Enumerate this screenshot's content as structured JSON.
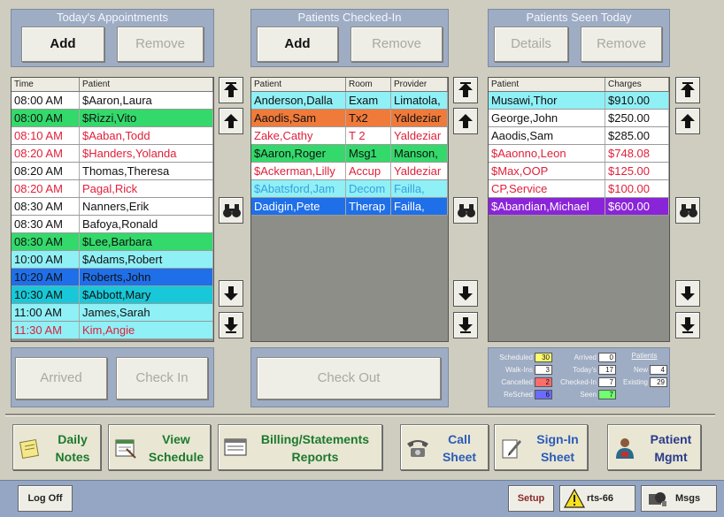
{
  "appointments": {
    "title": "Today's Appointments",
    "add_label": "Add",
    "remove_label": "Remove",
    "columns": [
      "Time",
      "Patient"
    ],
    "rows": [
      {
        "time": "08:00 AM",
        "patient": "$Aaron,Laura",
        "bg": "#ffffff",
        "fg": "#111111"
      },
      {
        "time": "08:00 AM",
        "patient": "$Rizzi,Vito",
        "bg": "#33d96b",
        "fg": "#111111"
      },
      {
        "time": "08:10 AM",
        "patient": "$Aaban,Todd",
        "bg": "#ffffff",
        "fg": "#e0203a"
      },
      {
        "time": "08:20 AM",
        "patient": "$Handers,Yolanda",
        "bg": "#ffffff",
        "fg": "#e0203a"
      },
      {
        "time": "08:20 AM",
        "patient": "Thomas,Theresa",
        "bg": "#ffffff",
        "fg": "#111111"
      },
      {
        "time": "08:20 AM",
        "patient": "Pagal,Rick",
        "bg": "#ffffff",
        "fg": "#e0203a"
      },
      {
        "time": "08:30 AM",
        "patient": "Nanners,Erik",
        "bg": "#ffffff",
        "fg": "#111111"
      },
      {
        "time": "08:30 AM",
        "patient": "Bafoya,Ronald",
        "bg": "#ffffff",
        "fg": "#111111"
      },
      {
        "time": "08:30 AM",
        "patient": "$Lee,Barbara",
        "bg": "#33d96b",
        "fg": "#111111"
      },
      {
        "time": "10:00 AM",
        "patient": "$Adams,Robert",
        "bg": "#8ff0f6",
        "fg": "#111111"
      },
      {
        "time": "10:20 AM",
        "patient": "Roberts,John",
        "bg": "#1f6fe8",
        "fg": "#111111"
      },
      {
        "time": "10:30 AM",
        "patient": "$Abbott,Mary",
        "bg": "#18c8d8",
        "fg": "#111111"
      },
      {
        "time": "11:00 AM",
        "patient": "James,Sarah",
        "bg": "#8ff0f6",
        "fg": "#111111"
      },
      {
        "time": "11:30 AM",
        "patient": "Kim,Angie",
        "bg": "#8ff0f6",
        "fg": "#e0203a"
      }
    ]
  },
  "checked_in": {
    "title": "Patients Checked-In",
    "add_label": "Add",
    "remove_label": "Remove",
    "columns": [
      "Patient",
      "Room",
      "Provider"
    ],
    "rows": [
      {
        "patient": "Anderson,Dalla",
        "room": "Exam",
        "provider": "Limatola,",
        "bg": "#8ff0f6",
        "fg": "#111111"
      },
      {
        "patient": "Aaodis,Sam",
        "room": "Tx2",
        "provider": "Yaldeziar",
        "bg": "#f07a3a",
        "fg": "#111111"
      },
      {
        "patient": "Zake,Cathy",
        "room": "T 2",
        "provider": "Yaldeziar",
        "bg": "#ffffff",
        "fg": "#e0203a"
      },
      {
        "patient": "$Aaron,Roger",
        "room": "Msg1",
        "provider": "Manson,",
        "bg": "#33d96b",
        "fg": "#111111"
      },
      {
        "patient": "$Ackerman,Lilly",
        "room": "Accup",
        "provider": "Yaldeziar",
        "bg": "#ffffff",
        "fg": "#e0203a"
      },
      {
        "patient": "$Abatsford,Jam",
        "room": "Decom",
        "provider": "Failla,",
        "bg": "#8ff0f6",
        "fg": "#3aa0e0"
      },
      {
        "patient": "Dadigin,Pete",
        "room": "Therap",
        "provider": "Failla,",
        "bg": "#1f6fe8",
        "fg": "#ffffff"
      }
    ],
    "checkout_label": "Check Out"
  },
  "seen_today": {
    "title": "Patients Seen Today",
    "details_label": "Details",
    "remove_label": "Remove",
    "columns": [
      "Patient",
      "Charges"
    ],
    "rows": [
      {
        "patient": "Musawi,Thor",
        "charges": "$910.00",
        "bg": "#8ff0f6",
        "fg": "#111111"
      },
      {
        "patient": "George,John",
        "charges": "$250.00",
        "bg": "#ffffff",
        "fg": "#111111"
      },
      {
        "patient": "Aaodis,Sam",
        "charges": "$285.00",
        "bg": "#ffffff",
        "fg": "#111111"
      },
      {
        "patient": "$Aaonno,Leon",
        "charges": "$748.08",
        "bg": "#ffffff",
        "fg": "#e0203a"
      },
      {
        "patient": "$Max,OOP",
        "charges": "$125.00",
        "bg": "#ffffff",
        "fg": "#e0203a"
      },
      {
        "patient": "CP,Service",
        "charges": "$100.00",
        "bg": "#ffffff",
        "fg": "#e0203a"
      },
      {
        "patient": "$Abandian,Michael",
        "charges": "$600.00",
        "bg": "#8a24d8",
        "fg": "#ffffff"
      }
    ]
  },
  "actions": {
    "arrived_label": "Arrived",
    "checkin_label": "Check In"
  },
  "stats": {
    "scheduled": {
      "label": "Scheduled",
      "value": "30",
      "color": "#ffff70"
    },
    "walkins": {
      "label": "Walk-Ins",
      "value": "3",
      "color": "#ffffff"
    },
    "cancelled": {
      "label": "Cancelled",
      "value": "2",
      "color": "#ff6d6d"
    },
    "rescheduled": {
      "label": "ReSched",
      "value": "6",
      "color": "#6b6bff"
    },
    "arrived": {
      "label": "Arrived",
      "value": "0",
      "color": "#ffffff"
    },
    "todays": {
      "label": "Today's",
      "value": "17",
      "color": "#ffffff"
    },
    "checked_in": {
      "label": "Checked-In",
      "value": "7",
      "color": "#ffffff"
    },
    "seen": {
      "label": "Seen",
      "value": "7",
      "color": "#70ff70"
    },
    "patients_header": "Patients",
    "new": {
      "label": "New",
      "value": "4",
      "color": "#ffffff"
    },
    "existing": {
      "label": "Existing",
      "value": "29",
      "color": "#ffffff"
    }
  },
  "nav": {
    "daily_notes": [
      "Daily",
      "Notes"
    ],
    "view_schedule": [
      "View",
      "Schedule"
    ],
    "billing": [
      "Billing/Statements",
      "Reports"
    ],
    "call_sheet": [
      "Call",
      "Sheet"
    ],
    "signin_sheet": [
      "Sign-In",
      "Sheet"
    ],
    "patient_mgmt": [
      "Patient",
      "Mgmt"
    ]
  },
  "bottom": {
    "logoff_label": "Log Off",
    "setup_label": "Setup",
    "alerts_label": "rts-66",
    "msgs_label": "Msgs"
  }
}
